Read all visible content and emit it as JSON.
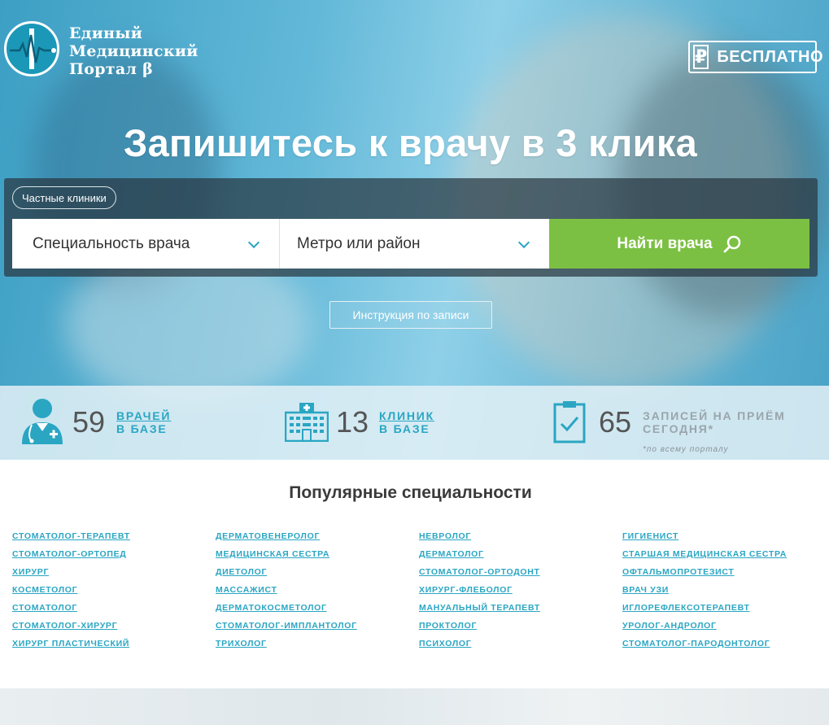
{
  "logo": {
    "line1": "Единый",
    "line2": "Медицинский",
    "line3": "Портал β"
  },
  "badge": {
    "icon": "ruble-icon",
    "label": "БЕСПЛАТНО"
  },
  "headline": "Запишитесь к врачу в 3 клика",
  "search": {
    "chip": "Частные клиники",
    "specialty_placeholder": "Специальность врача",
    "location_placeholder": "Метро или район",
    "button_label": "Найти врача"
  },
  "instruction_button": "Инструкция по записи",
  "stats": [
    {
      "icon": "doctor-icon",
      "value": "59",
      "line1": "ВРАЧЕЙ",
      "line2": "В БАЗЕ"
    },
    {
      "icon": "hospital-icon",
      "value": "13",
      "line1": "КЛИНИК",
      "line2": "В БАЗЕ"
    },
    {
      "icon": "clipboard-check-icon",
      "value": "65",
      "line1": "ЗАПИСЕЙ НА ПРИЁМ",
      "line2": "СЕГОДНЯ*",
      "note": "*по всему порталу"
    }
  ],
  "popular": {
    "title": "Популярные специальности",
    "columns": [
      [
        "стоматолог-терапевт",
        "стоматолог-ортопед",
        "хирург",
        "косметолог",
        "стоматолог",
        "стоматолог-хирург",
        "хирург пластический"
      ],
      [
        "дерматовенеролог",
        "медицинская сестра",
        "диетолог",
        "массажист",
        "дерматокосметолог",
        "стоматолог-имплантолог",
        "трихолог"
      ],
      [
        "невролог",
        "дерматолог",
        "стоматолог-ортодонт",
        "хирург-флеболог",
        "мануальный терапевт",
        "проктолог",
        "психолог"
      ],
      [
        "гигиенист",
        "старшая медицинская сестра",
        "офтальмопротезист",
        "врач узи",
        "иглорефлексотерапевт",
        "уролог-андролог",
        "стоматолог-пародонтолог"
      ]
    ]
  },
  "colors": {
    "accent": "#2aa6c3",
    "green": "#7cc043"
  }
}
